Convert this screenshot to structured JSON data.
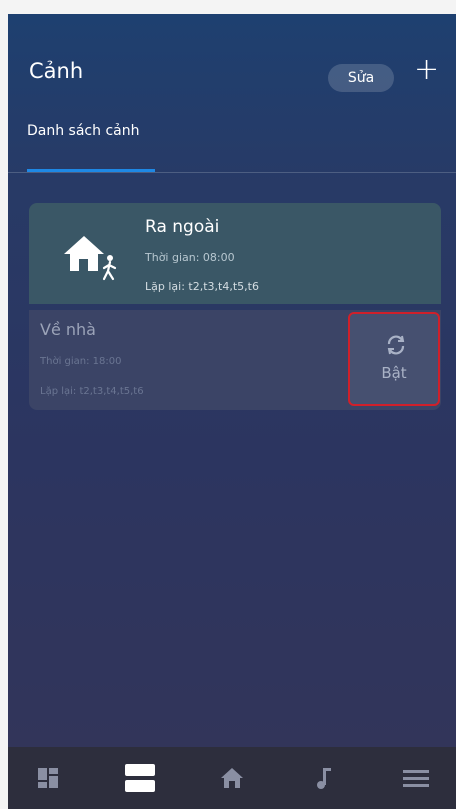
{
  "header": {
    "title": "Cảnh",
    "edit_label": "Sửa",
    "add_label": "+"
  },
  "tabs": [
    {
      "label": "Danh sách cảnh",
      "active": true
    }
  ],
  "scenes": [
    {
      "name": "Ra ngoài",
      "time": "Thời gian: 08:00",
      "repeat": "Lặp lại: t2,t3,t4,t5,t6",
      "icon": "home-walk-icon"
    },
    {
      "name": "Về nhà",
      "time": "Thời gian: 18:00",
      "repeat": "Lặp lại: t2,t3,t4,t5,t6",
      "action_label": "Bật",
      "action_icon": "refresh-icon"
    }
  ],
  "bottom_nav": [
    {
      "name": "dashboard-icon"
    },
    {
      "name": "scenes-icon",
      "active": true
    },
    {
      "name": "home-icon"
    },
    {
      "name": "music-icon"
    },
    {
      "name": "menu-icon"
    }
  ],
  "colors": {
    "accent": "#1e88e5",
    "highlight_border": "#d0202a"
  }
}
